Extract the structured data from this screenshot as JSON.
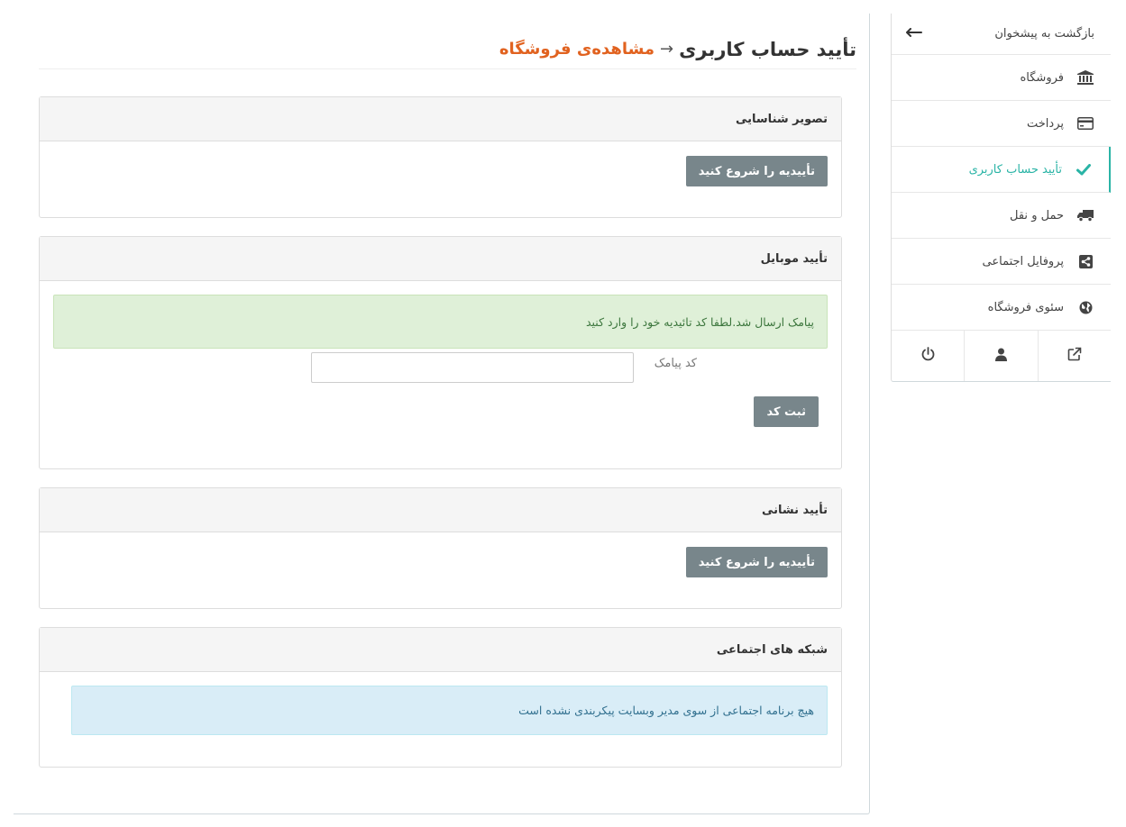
{
  "sidebar": {
    "back_label": "بازگشت به پیشخوان",
    "items": [
      {
        "label": "فروشگاه",
        "icon": "bank-icon"
      },
      {
        "label": "پرداخت",
        "icon": "credit-card-icon"
      },
      {
        "label": "تأیید حساب کاربری",
        "icon": "check-icon",
        "active": true
      },
      {
        "label": "حمل و نقل",
        "icon": "truck-icon"
      },
      {
        "label": "پروفایل اجتماعی",
        "icon": "share-square-icon"
      },
      {
        "label": "سئوی فروشگاه",
        "icon": "globe-icon"
      }
    ],
    "footer_icons": [
      "external-link-icon",
      "user-icon",
      "power-icon"
    ]
  },
  "header": {
    "title": "تأیید حساب کاربری",
    "arrow": "→",
    "view_store_link": "مشاهده‌ی فروشگاه"
  },
  "panels": {
    "id_image": {
      "title": "تصویر شناسایی",
      "button": "تأییدیه را شروع کنید"
    },
    "mobile": {
      "title": "تأیید موبایل",
      "alert": "پیامک ارسال شد.لطفا کد تائیدیه خود را وارد کنید",
      "sms_label": "کد پیامک",
      "sms_value": "",
      "submit_button": "ثبت کد"
    },
    "address": {
      "title": "تأیید نشانی",
      "button": "تأییدیه را شروع کنید"
    },
    "social": {
      "title": "شبکه های اجتماعی",
      "alert": "هیچ برنامه اجتماعی از سوی مدیر وبسایت پیکربندی نشده است"
    }
  },
  "colors": {
    "accent": "#2ab4a6",
    "link_orange": "#e1621f",
    "button_gray": "#78868b",
    "success_bg": "#dff0d8",
    "info_bg": "#d9edf7"
  }
}
